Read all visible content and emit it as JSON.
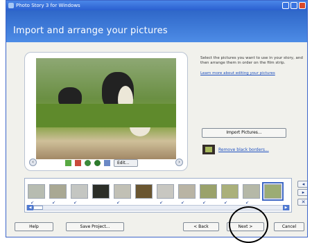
{
  "window": {
    "title": "Photo Story 3 for Windows"
  },
  "header": {
    "title": "Import and arrange your pictures"
  },
  "instructions": {
    "text": "Select the pictures you want to use in your story, and then arrange them in order on the film strip.",
    "learn_more": "Learn more about editing your pictures"
  },
  "preview": {
    "edit_label": "Edit..."
  },
  "actions": {
    "import_label": "Import Pictures...",
    "remove_borders_label": "Remove black borders..."
  },
  "filmstrip": {
    "thumbnail_count": 12,
    "selected_index": 11
  },
  "buttons": {
    "help": "Help",
    "save": "Save Project...",
    "back": "< Back",
    "next": "Next >",
    "cancel": "Cancel"
  },
  "colors": {
    "header_blue": "#2f67c8",
    "annotation": "#000000"
  }
}
